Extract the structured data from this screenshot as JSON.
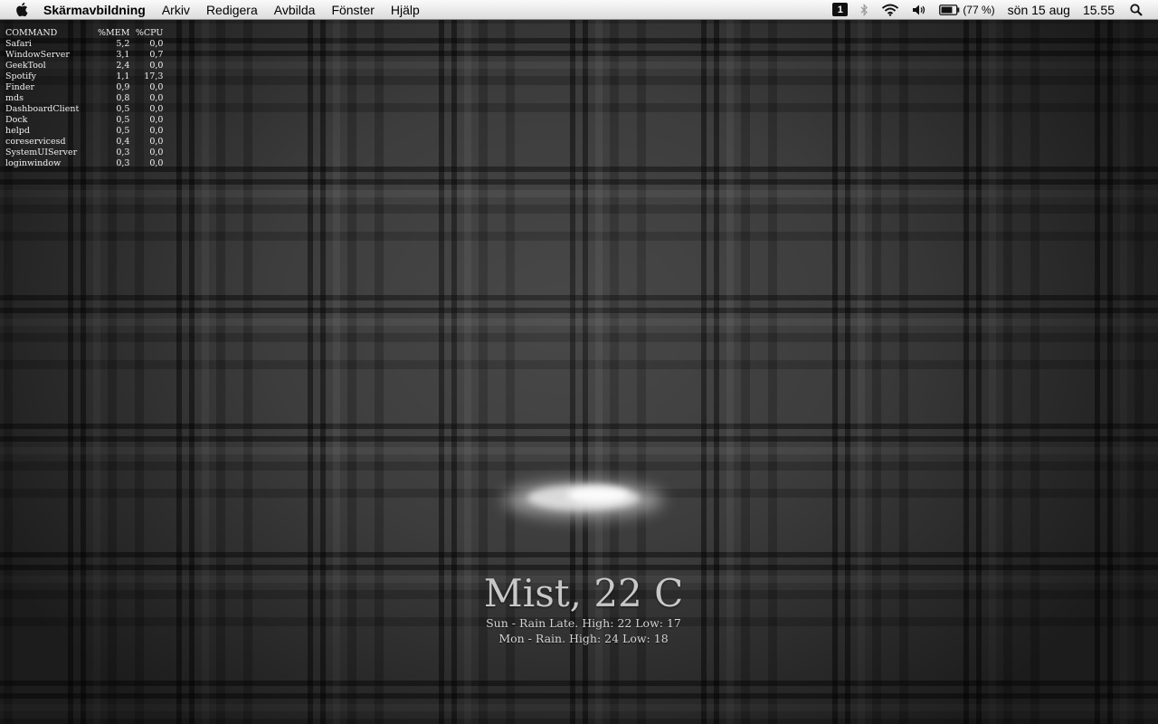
{
  "menubar": {
    "apple_icon": "apple-logo-icon",
    "app_name": "Skärmavbildning",
    "menus": [
      "Arkiv",
      "Redigera",
      "Avbilda",
      "Fönster",
      "Hjälp"
    ],
    "status": {
      "space_number": "1",
      "bluetooth_icon": "bluetooth-icon",
      "wifi_icon": "wifi-icon",
      "volume_icon": "volume-icon",
      "battery_icon": "battery-icon",
      "battery_percent": "(77 %)",
      "battery_level": 0.77,
      "date": "sön 15 aug",
      "time": "15.55",
      "spotlight_icon": "spotlight-search-icon"
    }
  },
  "process_list": {
    "headers": [
      "COMMAND",
      "%MEM",
      "%CPU"
    ],
    "rows": [
      [
        "Safari",
        "5,2",
        "0,0"
      ],
      [
        "WindowServer",
        "3,1",
        "0,7"
      ],
      [
        "GeekTool",
        "2,4",
        "0,0"
      ],
      [
        "Spotify",
        "1,1",
        "17,3"
      ],
      [
        "Finder",
        "0,9",
        "0,0"
      ],
      [
        "mds",
        "0,8",
        "0,0"
      ],
      [
        "DashboardClient",
        "0,5",
        "0,0"
      ],
      [
        "Dock",
        "0,5",
        "0,0"
      ],
      [
        "helpd",
        "0,5",
        "0,0"
      ],
      [
        "coreservicesd",
        "0,4",
        "0,0"
      ],
      [
        "SystemUIServer",
        "0,3",
        "0,0"
      ],
      [
        "loginwindow",
        "0,3",
        "0,0"
      ]
    ]
  },
  "weather": {
    "icon": "mist-cloud-icon",
    "current": "Mist, 22 C",
    "forecast": [
      "Sun - Rain Late. High: 22 Low: 17",
      "Mon - Rain. High: 24 Low: 18"
    ]
  },
  "colors": {
    "menubar_bg": "#e8e8e8",
    "wallpaper_base": "#3d3d3d",
    "widget_text": "#f0f0f0"
  }
}
